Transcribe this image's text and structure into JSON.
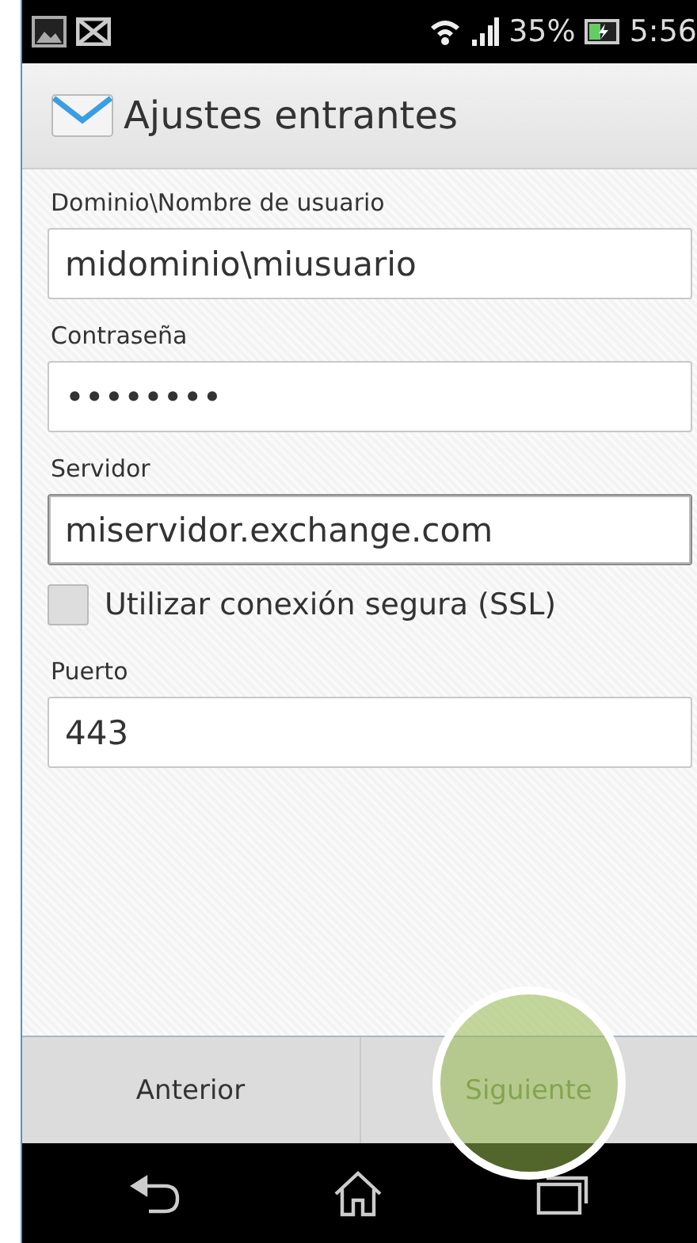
{
  "status_bar": {
    "battery": "35%",
    "time": "5:56"
  },
  "action_bar": {
    "title": "Ajustes entrantes"
  },
  "form": [
    {
      "kind": "field",
      "label": "Dominio\\Nombre de usuario",
      "value": "midominio\\miusuario"
    },
    {
      "kind": "field",
      "label": "Contraseña",
      "value": "••••••••"
    },
    {
      "kind": "field",
      "label": "Servidor",
      "value": "miservidor.exchange.com",
      "focused": true
    },
    {
      "kind": "checkbox",
      "label": "Utilizar conexión segura (SSL)",
      "checked": false
    },
    {
      "kind": "field",
      "label": "Puerto",
      "value": "443"
    }
  ],
  "buttons": [
    {
      "label": "Anterior",
      "pressed": false
    },
    {
      "label": "Siguiente",
      "pressed": true
    }
  ]
}
